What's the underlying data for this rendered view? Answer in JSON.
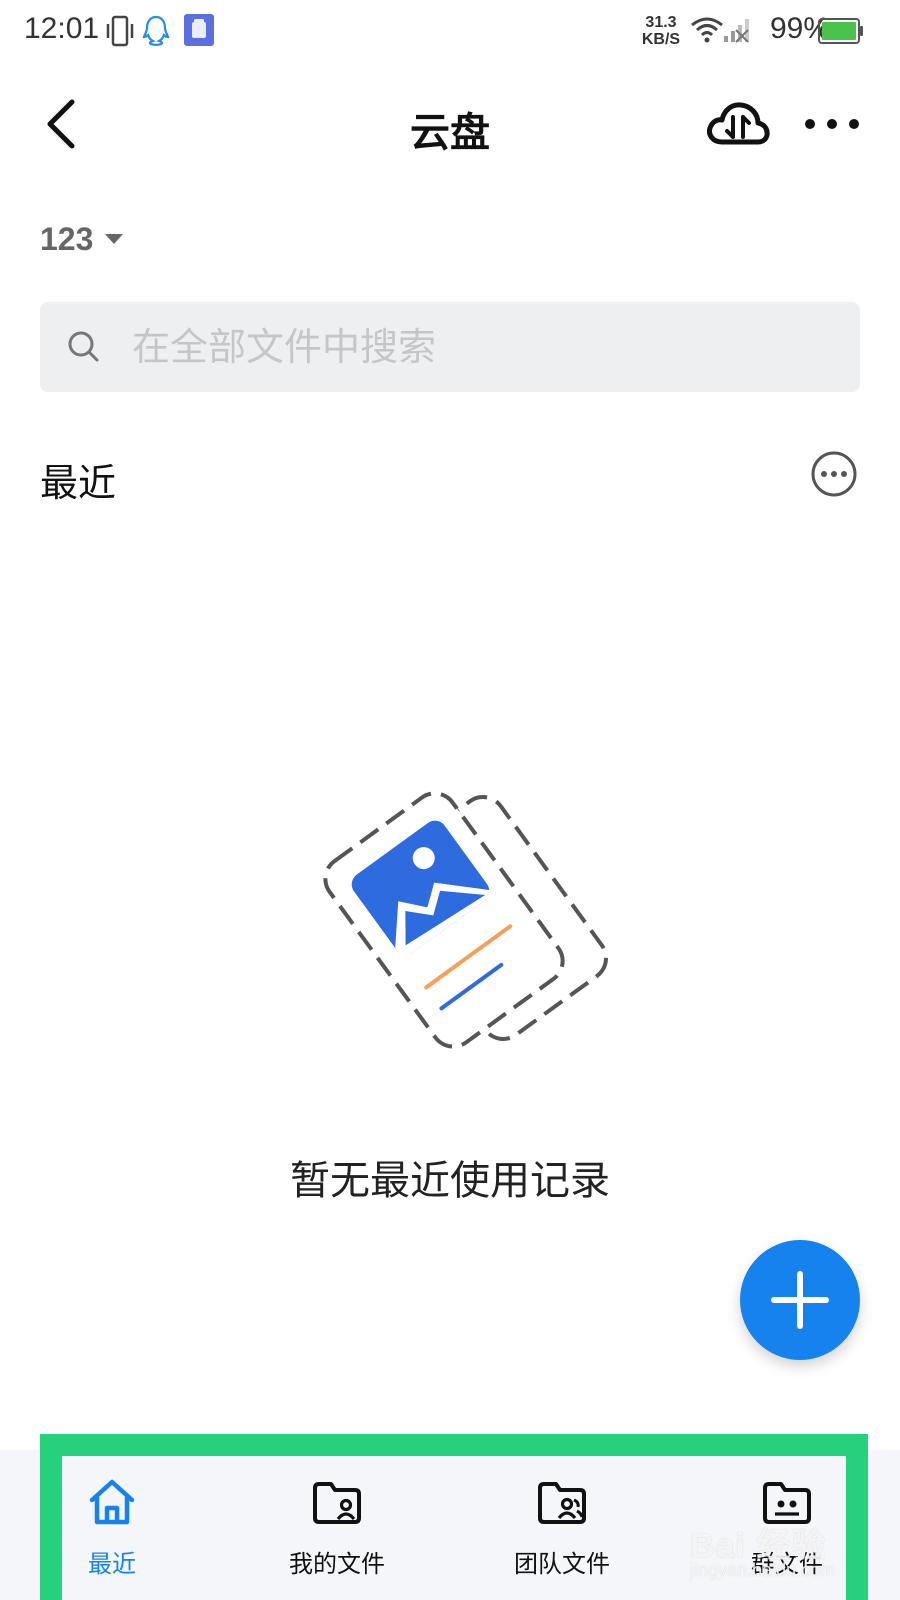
{
  "status_bar": {
    "time": "12:01",
    "net_speed_value": "31.3",
    "net_speed_unit": "KB/S",
    "battery": "99%",
    "icons": [
      "vibrate-icon",
      "qq-icon",
      "app-notification-icon",
      "wifi-icon",
      "cellular-signal-icon",
      "battery-icon"
    ]
  },
  "header": {
    "title": "云盘",
    "back_icon": "back-arrow-icon",
    "transfer_icon": "cloud-transfer-icon",
    "more_icon": "more-icon"
  },
  "account": {
    "name": "123",
    "dropdown_icon": "caret-down-icon"
  },
  "search": {
    "placeholder": "在全部文件中搜索",
    "value": "",
    "icon": "search-icon"
  },
  "recent": {
    "title": "最近",
    "more_icon": "more-circle-icon",
    "empty_message": "暂无最近使用记录",
    "empty_illustration": "empty-files-illustration"
  },
  "fab": {
    "icon": "plus-icon"
  },
  "tabs": [
    {
      "label": "最近",
      "icon": "home-icon",
      "active": true
    },
    {
      "label": "我的文件",
      "icon": "folder-user-icon",
      "active": false
    },
    {
      "label": "团队文件",
      "icon": "folder-team-icon",
      "active": false
    },
    {
      "label": "群文件",
      "icon": "folder-group-icon",
      "active": false
    }
  ],
  "watermark": {
    "text": "Bai 经验",
    "sub": "jingyan.baidu.com"
  },
  "colors": {
    "accent": "#1582ee",
    "highlight_frame": "#26d07c",
    "search_bg": "#eeeff1",
    "tab_bar_bg": "#f4f6fa",
    "illustration_orange": "#f5a05a"
  }
}
